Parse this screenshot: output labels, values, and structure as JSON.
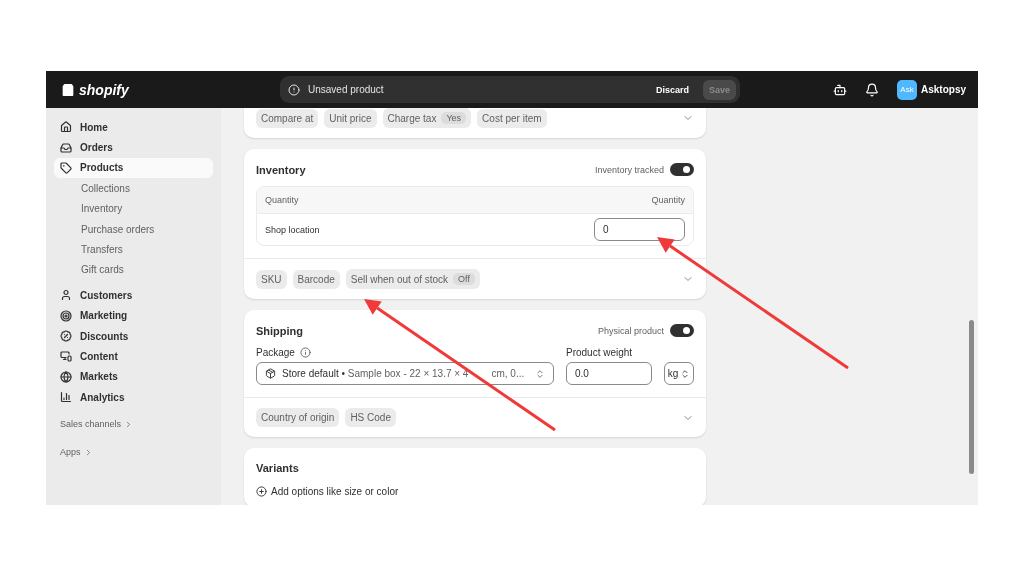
{
  "topbar": {
    "logo": "shopify",
    "notice": "Unsaved product",
    "buttons": [
      {
        "label": "Discard",
        "disabled": false
      },
      {
        "label": "Save",
        "disabled": true
      }
    ],
    "user": {
      "initials": "Ask",
      "name": "Asktopsy"
    }
  },
  "sidebar": {
    "items": [
      {
        "label": "Home",
        "selected": false
      },
      {
        "label": "Orders",
        "selected": false
      },
      {
        "label": "Products",
        "selected": true,
        "children": [
          {
            "label": "Collections"
          },
          {
            "label": "Inventory"
          },
          {
            "label": "Purchase orders"
          },
          {
            "label": "Transfers"
          },
          {
            "label": "Gift cards"
          }
        ]
      },
      {
        "label": "Customers",
        "selected": false
      },
      {
        "label": "Marketing",
        "selected": false
      },
      {
        "label": "Discounts",
        "selected": false
      },
      {
        "label": "Content",
        "selected": false
      },
      {
        "label": "Markets",
        "selected": false
      },
      {
        "label": "Analytics",
        "selected": false
      }
    ],
    "sections": [
      "Sales channels",
      "Apps"
    ]
  },
  "pricing": {
    "chips": [
      {
        "label": "Compare at"
      },
      {
        "label": "Unit price"
      },
      {
        "label": "Charge tax",
        "value": "Yes"
      },
      {
        "label": "Cost per item"
      }
    ]
  },
  "inventory": {
    "title": "Inventory",
    "toggle": {
      "label": "Inventory tracked",
      "on": true
    },
    "table": {
      "columns": [
        "Quantity",
        "Quantity"
      ],
      "rows": [
        {
          "location": "Shop location",
          "quantity": "0"
        }
      ]
    },
    "chips": [
      {
        "label": "SKU"
      },
      {
        "label": "Barcode"
      },
      {
        "label": "Sell when out of stock",
        "value": "Off"
      }
    ]
  },
  "shipping": {
    "title": "Shipping",
    "toggle": {
      "label": "Physical product",
      "on": true
    },
    "package": {
      "label": "Package",
      "name": "Store default",
      "separator": "•",
      "detail": "Sample box - 22 × 13.7 × 4",
      "detail_end": "cm, 0..."
    },
    "weight": {
      "label": "Product weight",
      "value": "0.0",
      "unit": "kg"
    },
    "chips": [
      {
        "label": "Country of origin"
      },
      {
        "label": "HS Code"
      }
    ]
  },
  "variants": {
    "title": "Variants",
    "add": "Add options like size or color"
  }
}
